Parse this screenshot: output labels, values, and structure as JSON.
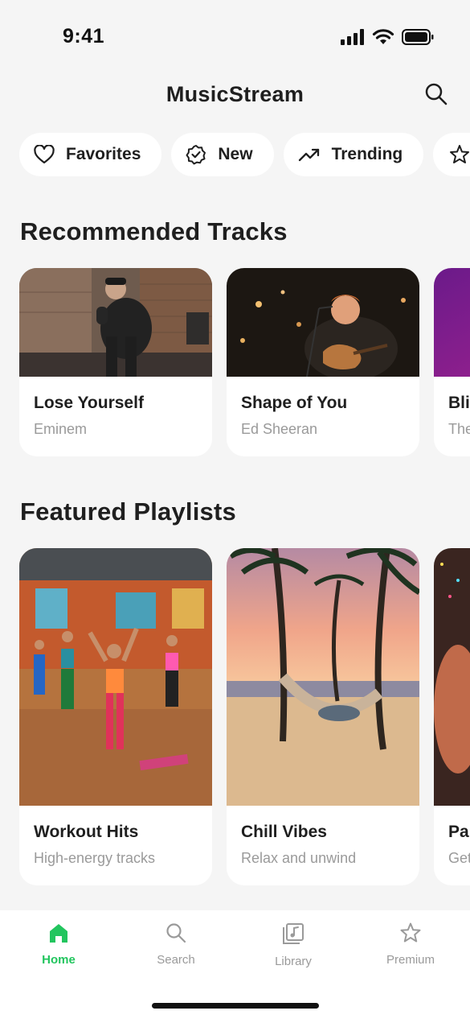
{
  "status_bar": {
    "time": "9:41"
  },
  "header": {
    "title": "MusicStream"
  },
  "chips": [
    {
      "label": "Favorites",
      "icon": "heart-icon"
    },
    {
      "label": "New",
      "icon": "badge-check-icon"
    },
    {
      "label": "Trending",
      "icon": "trending-up-icon"
    },
    {
      "label": "",
      "icon": "star-icon"
    }
  ],
  "recommended": {
    "title": "Recommended Tracks",
    "tracks": [
      {
        "title": "Lose Yourself",
        "artist": "Eminem"
      },
      {
        "title": "Shape of You",
        "artist": "Ed Sheeran"
      },
      {
        "title": "Bli",
        "artist": "The"
      }
    ]
  },
  "featured": {
    "title": "Featured Playlists",
    "playlists": [
      {
        "title": "Workout Hits",
        "subtitle": "High-energy tracks"
      },
      {
        "title": "Chill Vibes",
        "subtitle": "Relax and unwind"
      },
      {
        "title": "Pa",
        "subtitle": "Get"
      }
    ]
  },
  "tabbar": {
    "tabs": [
      {
        "label": "Home",
        "icon": "home-icon",
        "active": true
      },
      {
        "label": "Search",
        "icon": "search-icon",
        "active": false
      },
      {
        "label": "Library",
        "icon": "library-icon",
        "active": false
      },
      {
        "label": "Premium",
        "icon": "star-icon",
        "active": false
      }
    ]
  },
  "colors": {
    "accent": "#22c55e",
    "background": "#f5f5f5",
    "card": "#ffffff",
    "muted_text": "#9a9a9a"
  }
}
